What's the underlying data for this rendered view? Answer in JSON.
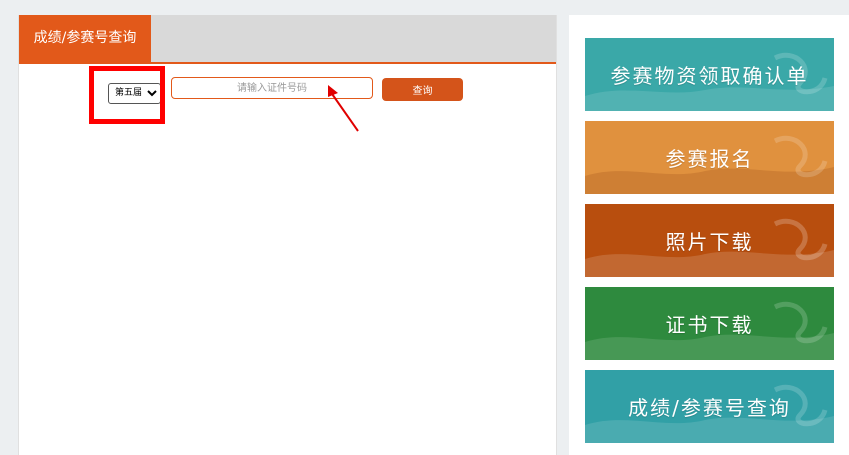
{
  "tab": {
    "label": "成绩/参赛号查询"
  },
  "search": {
    "edition_selected": "第五届",
    "input_placeholder": "请输入证件号码",
    "query_button_label": "查询"
  },
  "banners": [
    {
      "label": "参赛物资领取确认单",
      "color": "#3aa8a8",
      "icon": "calligraphy-decoration"
    },
    {
      "label": "参赛报名",
      "color": "#e0913e",
      "icon": "calligraphy-decoration"
    },
    {
      "label": "照片下载",
      "color": "#b84e0e",
      "icon": "calligraphy-decoration"
    },
    {
      "label": "证书下载",
      "color": "#2e8a3e",
      "icon": "calligraphy-decoration"
    },
    {
      "label": "成绩/参赛号查询",
      "color": "#31a0a6",
      "icon": "calligraphy-decoration"
    }
  ],
  "colors": {
    "accent": "#e2591a",
    "highlight": "#ff0000"
  }
}
